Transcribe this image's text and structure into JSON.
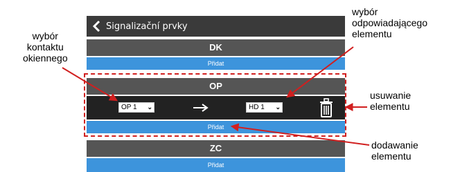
{
  "window": {
    "title": "Signalizační prvky"
  },
  "sections": [
    {
      "header": "DK",
      "add_label": "Přidat"
    },
    {
      "header": "OP",
      "add_label": "Přidat",
      "row": {
        "contact_select": "OP 1",
        "element_select": "HD 1"
      }
    },
    {
      "header": "ZC",
      "add_label": "Přidat"
    }
  ],
  "annotations": {
    "contact": [
      "wybór",
      "kontaktu",
      "okiennego"
    ],
    "element": [
      "wybór",
      "odpowiadającego",
      "elementu"
    ],
    "remove": [
      "usuwanie",
      "elementu"
    ],
    "add": [
      "dodawanie",
      "elementu"
    ]
  },
  "colors": {
    "titlebar": "#3a3a3a",
    "section_header": "#555555",
    "add_bar": "#3d94dc",
    "row_dark": "#222222",
    "annotation_red": "#d11f1f"
  },
  "icons": {
    "back": "chevron-left-icon",
    "arrow": "arrow-right-icon",
    "delete": "trash-icon"
  }
}
